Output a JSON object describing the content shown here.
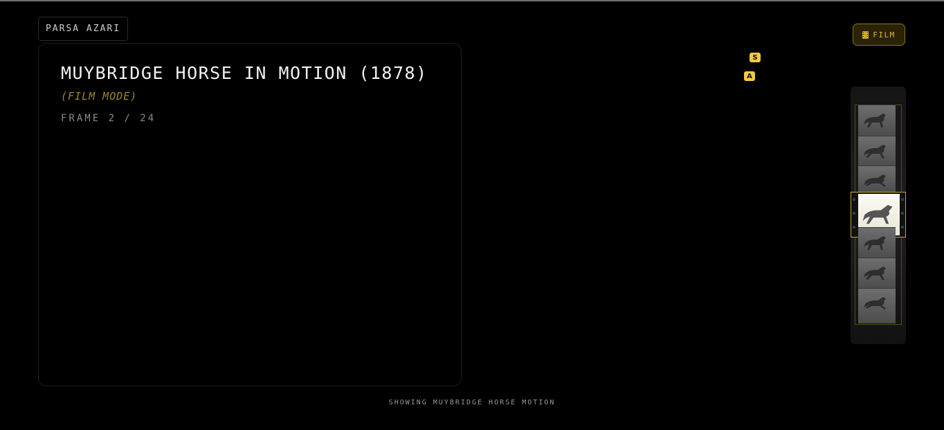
{
  "author": {
    "name": "PARSA AZARI"
  },
  "panel": {
    "title": "MUYBRIDGE HORSE IN MOTION (1878)",
    "mode": "(FILM MODE)",
    "frame_counter": "FRAME 2 / 24"
  },
  "shortcuts": {
    "s_key": "S",
    "a_key": "A"
  },
  "film_button": {
    "label": "FILM",
    "icon": "film-icon"
  },
  "filmstrip": {
    "current_frame": 2,
    "total_frames": 24,
    "visible_thumbnails": 7
  },
  "status": {
    "text": "SHOWING MUYBRIDGE HORSE MOTION"
  },
  "colors": {
    "background": "#000000",
    "accent": "#d7b83a",
    "badge": "#f2c744"
  }
}
